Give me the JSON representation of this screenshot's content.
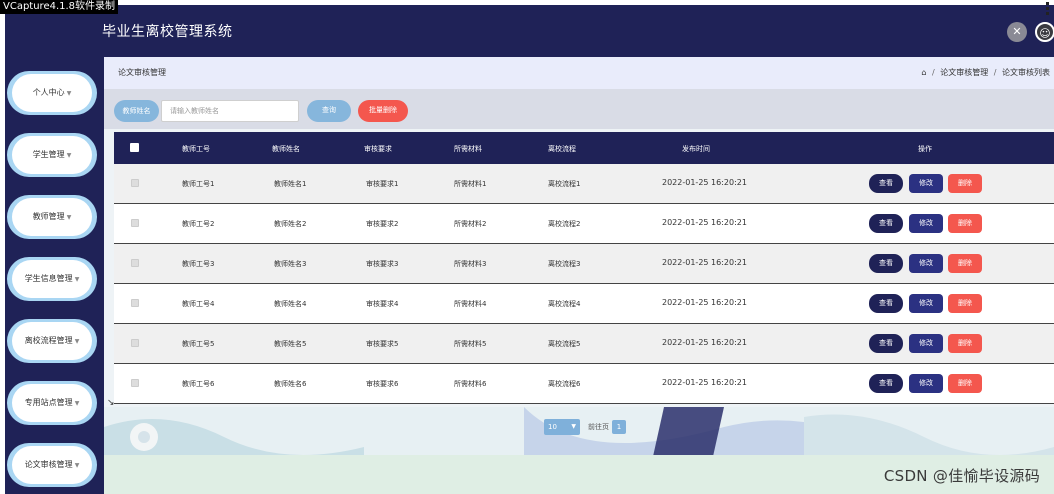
{
  "recorder_label": "VCapture4.1.8软件录制",
  "app": {
    "title": "毕业生离校管理系统"
  },
  "header_icons": {
    "close": "close-icon",
    "user": "user-icon"
  },
  "sidebar": {
    "items": [
      {
        "label": "个人中心"
      },
      {
        "label": "学生管理"
      },
      {
        "label": "教师管理"
      },
      {
        "label": "学生信息管理"
      },
      {
        "label": "离校流程管理"
      },
      {
        "label": "专用站点管理"
      },
      {
        "label": "论文审核管理"
      }
    ]
  },
  "breadcrumb": {
    "title": "论文审核管理",
    "home_icon": "home-icon",
    "path": [
      "论文审核管理",
      "论文审核列表"
    ]
  },
  "search": {
    "label": "教师姓名",
    "placeholder": "请输入教师姓名",
    "query_button": "查询",
    "batch_delete_button": "批量删除"
  },
  "table": {
    "headers": [
      "教师工号",
      "教师姓名",
      "审核要求",
      "所需材料",
      "离校流程",
      "发布时间",
      "操作"
    ],
    "rows": [
      {
        "id": "教师工号1",
        "name": "教师姓名1",
        "req": "审核要求1",
        "material": "所需材料1",
        "flow": "离校流程1",
        "time": "2022-01-25 16:20:21"
      },
      {
        "id": "教师工号2",
        "name": "教师姓名2",
        "req": "审核要求2",
        "material": "所需材料2",
        "flow": "离校流程2",
        "time": "2022-01-25 16:20:21"
      },
      {
        "id": "教师工号3",
        "name": "教师姓名3",
        "req": "审核要求3",
        "material": "所需材料3",
        "flow": "离校流程3",
        "time": "2022-01-25 16:20:21"
      },
      {
        "id": "教师工号4",
        "name": "教师姓名4",
        "req": "审核要求4",
        "material": "所需材料4",
        "flow": "离校流程4",
        "time": "2022-01-25 16:20:21"
      },
      {
        "id": "教师工号5",
        "name": "教师姓名5",
        "req": "审核要求5",
        "material": "所需材料5",
        "flow": "离校流程5",
        "time": "2022-01-25 16:20:21"
      },
      {
        "id": "教师工号6",
        "name": "教师姓名6",
        "req": "审核要求6",
        "material": "所需材料6",
        "flow": "离校流程6",
        "time": "2022-01-25 16:20:21"
      }
    ],
    "actions": {
      "view": "查看",
      "edit": "修改",
      "delete": "删除"
    }
  },
  "pagination": {
    "page_size": "10",
    "goto_label": "前往页",
    "current_page": "1"
  },
  "watermark": "CSDN @佳愉毕设源码",
  "colors": {
    "primary": "#1f2257",
    "accent": "#86b6dc",
    "danger": "#f4574e"
  }
}
